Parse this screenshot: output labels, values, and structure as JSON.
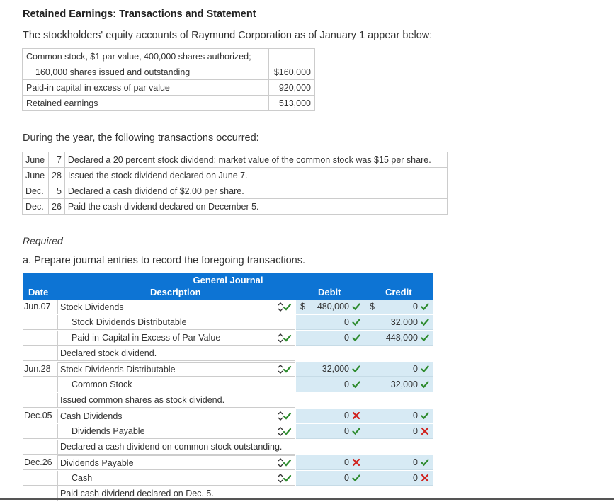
{
  "title": "Retained Earnings: Transactions and Statement",
  "intro": "The stockholders' equity accounts of Raymund Corporation as of January 1 appear below:",
  "equity": {
    "line1": "Common stock, $1 par value, 400,000 shares authorized;",
    "line2": "160,000 shares issued and outstanding",
    "line2_value": "$160,000",
    "rows": [
      {
        "label": "Paid-in capital in excess of par value",
        "value": "920,000"
      },
      {
        "label": "Retained earnings",
        "value": "513,000"
      }
    ]
  },
  "transactions_intro": "During the year, the following transactions occurred:",
  "transactions": [
    {
      "month": "June",
      "day": "7",
      "text": "Declared a 20 percent stock dividend; market value of the common stock was $15 per share."
    },
    {
      "month": "June",
      "day": "28",
      "text": "Issued the stock dividend declared on June 7."
    },
    {
      "month": "Dec.",
      "day": "5",
      "text": "Declared a cash dividend of $2.00 per share."
    },
    {
      "month": "Dec.",
      "day": "26",
      "text": "Paid the cash dividend declared on December 5."
    }
  ],
  "required_label": "Required",
  "question_a": "a. Prepare journal entries to record the foregoing transactions.",
  "journal": {
    "title": "General Journal",
    "col_date": "Date",
    "col_desc": "Description",
    "col_debit": "Debit",
    "col_credit": "Credit",
    "rows": [
      {
        "date": "Jun.07",
        "desc": "Stock Dividends",
        "level": 0,
        "arrow": true,
        "debit": "480,000",
        "debit_mark": "check",
        "credit": "0",
        "credit_mark": "check",
        "dollar": true
      },
      {
        "date": "",
        "desc": "Stock Dividends Distributable",
        "level": 1,
        "arrow": false,
        "debit": "0",
        "debit_mark": "check",
        "credit": "32,000",
        "credit_mark": "check"
      },
      {
        "date": "",
        "desc": "Paid-in-Capital in Excess of Par Value",
        "level": 1,
        "arrow": true,
        "debit": "0",
        "debit_mark": "check",
        "credit": "448,000",
        "credit_mark": "check"
      },
      {
        "date": "",
        "desc": "Declared stock dividend.",
        "narration": true
      },
      {
        "date": "Jun.28",
        "desc": "Stock Dividends Distributable",
        "level": 0,
        "arrow": true,
        "debit": "32,000",
        "debit_mark": "check",
        "credit": "0",
        "credit_mark": "check"
      },
      {
        "date": "",
        "desc": "Common Stock",
        "level": 1,
        "arrow": false,
        "debit": "0",
        "debit_mark": "check",
        "credit": "32,000",
        "credit_mark": "check"
      },
      {
        "date": "",
        "desc": "Issued common shares as stock dividend.",
        "narration": true
      },
      {
        "date": "Dec.05",
        "desc": "Cash Dividends",
        "level": 0,
        "arrow": true,
        "debit": "0",
        "debit_mark": "cross",
        "credit": "0",
        "credit_mark": "check"
      },
      {
        "date": "",
        "desc": "Dividends Payable",
        "level": 1,
        "arrow": true,
        "debit": "0",
        "debit_mark": "check",
        "credit": "0",
        "credit_mark": "cross"
      },
      {
        "date": "",
        "desc": "Declared a cash dividend on common stock outstanding.",
        "narration": true
      },
      {
        "date": "Dec.26",
        "desc": "Dividends Payable",
        "level": 0,
        "arrow": true,
        "debit": "0",
        "debit_mark": "cross",
        "credit": "0",
        "credit_mark": "check"
      },
      {
        "date": "",
        "desc": "Cash",
        "level": 1,
        "arrow": true,
        "debit": "0",
        "debit_mark": "check",
        "credit": "0",
        "credit_mark": "cross"
      },
      {
        "date": "",
        "desc": "Paid cash dividend declared on Dec. 5.",
        "narration": true
      }
    ]
  },
  "dollar_sign": "$",
  "colors": {
    "header": "#0d74d4",
    "cell": "#d7eaf4",
    "check": "#2e8b2e",
    "cross": "#d0211c"
  }
}
